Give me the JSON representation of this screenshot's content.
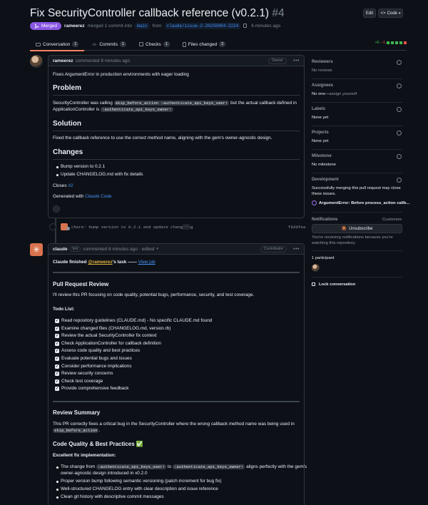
{
  "header": {
    "title": "Fix SecurityController callback reference (v0.2.1)",
    "number": "#4",
    "edit_label": "Edit",
    "code_label": "Code",
    "status": "Merged",
    "author": "rameerez",
    "merge_text": "merged 1 commit into",
    "base_branch": "main",
    "from_text": "from",
    "head_branch": "claude/issue-2-20250804-2224",
    "time": "6 minutes ago"
  },
  "tabs": [
    {
      "label": "Conversation",
      "count": "1"
    },
    {
      "label": "Commits",
      "count": "1"
    },
    {
      "label": "Checks",
      "count": "1"
    },
    {
      "label": "Files changed",
      "count": "2"
    }
  ],
  "diffstat": {
    "add": "+6",
    "del": "−1"
  },
  "comment1": {
    "author": "rameerez",
    "meta": "commented 8 minutes ago",
    "role": "Owner",
    "intro": "Fixes ArgumentError in production environments with eager loading",
    "h_problem": "Problem",
    "p1_a": "SecurityController was calling",
    "p1_code1": "skip_before_action :authenticate_api_keys_user!",
    "p1_b": "but the actual callback defined in",
    "p1_c": "ApplicationController is",
    "p1_code2": ":authenticate_api_keys_owner!",
    "h_solution": "Solution",
    "solution": "Fixed the callback reference to use the correct method name, aligning with the gem's owner-agnostic design.",
    "h_changes": "Changes",
    "changes": [
      "Bump version to 0.2.1",
      "Update CHANGELOG.md with fix details"
    ],
    "closes": "Closes",
    "closes_ref": "#2",
    "generated": "Generated with",
    "generated_link": "Claude Code"
  },
  "commit": {
    "message": "chore: bump version to 0.2.1 and update changelog",
    "ellipsis": "…",
    "sha": "f920fea"
  },
  "comment2": {
    "author": "claude",
    "bot": "bot",
    "meta": "commented 8 minutes ago · edited",
    "role": "Contributor",
    "finished_a": "Claude finished",
    "finished_mention": "@rameerez",
    "finished_b": "'s task ——",
    "view_job": "View job",
    "h_review": "Pull Request Review",
    "review_intro": "I'll review this PR focusing on code quality, potential bugs, performance, security, and test coverage.",
    "todo_title": "Todo List:",
    "todos": [
      "Read repository guidelines (CLAUDE.md) - No specific CLAUDE.md found",
      "Examine changed files (CHANGELOG.md, version.rb)",
      "Review the actual SecurityController fix context",
      "Check ApplicationController for callback definition",
      "Assess code quality and best practices",
      "Evaluate potential bugs and issues",
      "Consider performance implications",
      "Review security concerns",
      "Check test coverage",
      "Provide comprehensive feedback"
    ],
    "h_summary": "Review Summary",
    "summary_a": "This PR correctly fixes a critical bug in the SecurityController where the wrong callback method name was being used in",
    "summary_code": "skip_before_action",
    "summary_b": ".",
    "h_quality": "Code Quality & Best Practices ✅",
    "excellent": "Excellent fix implementation:",
    "b1_a": "The change from",
    "b1_code1": ":authenticate_api_keys_user!",
    "b1_b": "to",
    "b1_code2": ":authenticate_api_keys_owner!",
    "b1_c": "aligns perfectly with the gem's",
    "b1_d": "owner-agnostic design introduced in v0.2.0",
    "b2": "Proper version bump following semantic versioning (patch increment for bug fix)",
    "b3": "Well-structured CHANGELOG entry with clear description and issue reference",
    "b4": "Clean git history with descriptive commit messages"
  },
  "sidebar": {
    "reviewers": "Reviewers",
    "reviewers_val": "No reviews",
    "assignees": "Assignees",
    "assignees_val": "No one—",
    "assign_yourself": "assign yourself",
    "labels": "Labels",
    "labels_val": "None yet",
    "projects": "Projects",
    "projects_val": "None yet",
    "milestone": "Milestone",
    "milestone_val": "No milestone",
    "development": "Development",
    "dev_text1": "Successfully merging this pull request may close",
    "dev_text2": "these issues.",
    "dev_issue": "ArgumentError: Before process_action callb...",
    "notifications": "Notifications",
    "customize": "Customize",
    "unsubscribe": "Unsubscribe",
    "notif_text1": "You're receiving notifications because you're",
    "notif_text2": "watching this repository.",
    "participants": "1 participant",
    "lock": "Lock conversation"
  }
}
